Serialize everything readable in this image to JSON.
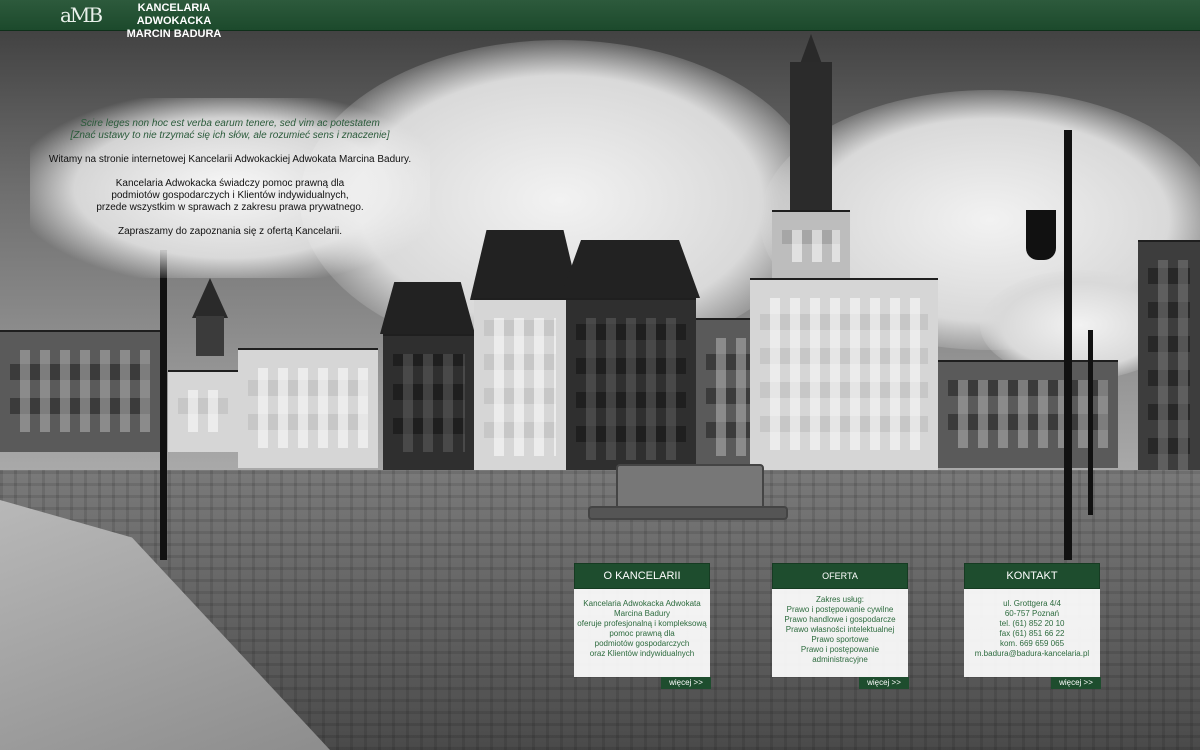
{
  "header": {
    "logo_text": "aMB",
    "brand_line1": "KANCELARIA ADWOKACKA",
    "brand_line2": "MARCIN BADURA"
  },
  "welcome": {
    "quote_line1": "Scire leges non hoc est verba earum tenere, sed vim ac potestatem",
    "quote_line2": "[Znać ustawy to nie trzymać się ich słów, ale rozumieć sens i znaczenie]",
    "intro": "Witamy na stronie internetowej Kancelarii Adwokackiej Adwokata Marcina Badury.",
    "offer_line1": "Kancelaria Adwokacka świadczy pomoc prawną dla",
    "offer_line2": "podmiotów gospodarczych i Klientów indywidualnych,",
    "offer_line3": "przede wszystkim w sprawach z zakresu prawa prywatnego.",
    "invite": "Zapraszamy do zapoznania się z ofertą Kancelarii."
  },
  "cards": {
    "about": {
      "title": "O KANCELARII",
      "lines": [
        "Kancelaria Adwokacka Adwokata",
        "Marcina Badury",
        "oferuje profesjonalną i kompleksową",
        "pomoc prawną dla",
        "podmiotów gospodarczych",
        "oraz Klientów indywidualnych"
      ],
      "more": "więcej >>"
    },
    "offer": {
      "title": "OFERTA",
      "lines": [
        "Zakres usług:",
        "Prawo i postępowanie cywilne",
        "Prawo handlowe i gospodarcze",
        "Prawo własności intelektualnej",
        "Prawo sportowe",
        "Prawo i postępowanie",
        "administracyjne"
      ],
      "more": "więcej >>"
    },
    "contact": {
      "title": "KONTAKT",
      "lines": [
        "ul. Grottgera 4/4",
        "60-757 Poznań",
        "tel. (61) 852 20 10",
        "fax (61) 851 66 22",
        "kom. 669 659 065",
        "m.badura@badura-kancelaria.pl"
      ],
      "more": "więcej >>"
    }
  }
}
